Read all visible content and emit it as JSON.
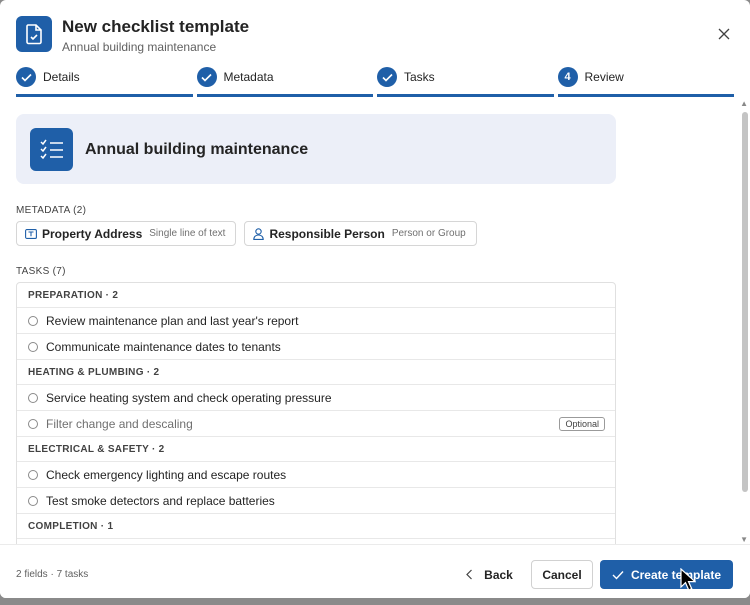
{
  "header": {
    "title": "New checklist template",
    "subtitle": "Annual building maintenance"
  },
  "stepper": {
    "steps": [
      {
        "label": "Details",
        "state": "done"
      },
      {
        "label": "Metadata",
        "state": "done"
      },
      {
        "label": "Tasks",
        "state": "done"
      },
      {
        "label": "Review",
        "number": "4",
        "state": "current"
      }
    ]
  },
  "banner": {
    "title": "Annual building maintenance"
  },
  "metadata": {
    "label": "METADATA (2)",
    "fields": [
      {
        "name": "Property Address",
        "type": "Single line of text",
        "icon": "text-field-icon"
      },
      {
        "name": "Responsible Person",
        "type": "Person or Group",
        "icon": "person-icon"
      }
    ]
  },
  "tasks": {
    "label": "TASKS (7)",
    "groups": [
      {
        "heading": "PREPARATION · 2",
        "items": [
          {
            "label": "Review maintenance plan and last year's report"
          },
          {
            "label": "Communicate maintenance dates to tenants"
          }
        ]
      },
      {
        "heading": "HEATING & PLUMBING · 2",
        "items": [
          {
            "label": "Service heating system and check operating pressure"
          },
          {
            "label": "Filter change and descaling",
            "optional": "Optional"
          }
        ]
      },
      {
        "heading": "ELECTRICAL & SAFETY · 2",
        "items": [
          {
            "label": "Check emergency lighting and escape routes"
          },
          {
            "label": "Test smoke detectors and replace batteries"
          }
        ]
      },
      {
        "heading": "COMPLETION · 1",
        "items": []
      }
    ]
  },
  "footer": {
    "summary": "2 fields · 7 tasks",
    "back_label": "Back",
    "cancel_label": "Cancel",
    "create_label": "Create template"
  },
  "colors": {
    "accent": "#1f5fa8",
    "banner_bg": "#eceff8"
  }
}
